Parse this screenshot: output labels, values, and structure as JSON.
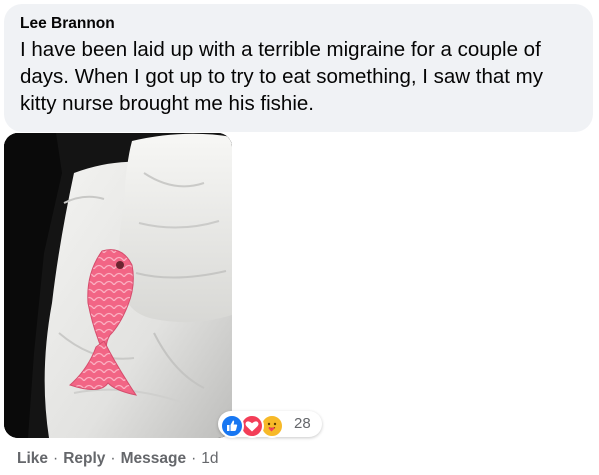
{
  "comment": {
    "author": "Lee Brannon",
    "text": "I have been laid up with a terrible migraine for a couple of days. When I got up to try to eat something, I saw that my kitty nurse brought me his fishie."
  },
  "reactions": {
    "types": [
      "like-icon",
      "love-icon",
      "care-icon"
    ],
    "count": "28"
  },
  "actions": {
    "like": "Like",
    "reply": "Reply",
    "message": "Message",
    "separator": "·",
    "time": "1d"
  },
  "colors": {
    "bubble": "#f0f2f5",
    "text": "#050505",
    "meta": "#65676b",
    "like_blue": "#1877f2",
    "love_red": "#f33e58",
    "care_yellow": "#f7b928",
    "fish_pink": "#ee5f7f"
  }
}
